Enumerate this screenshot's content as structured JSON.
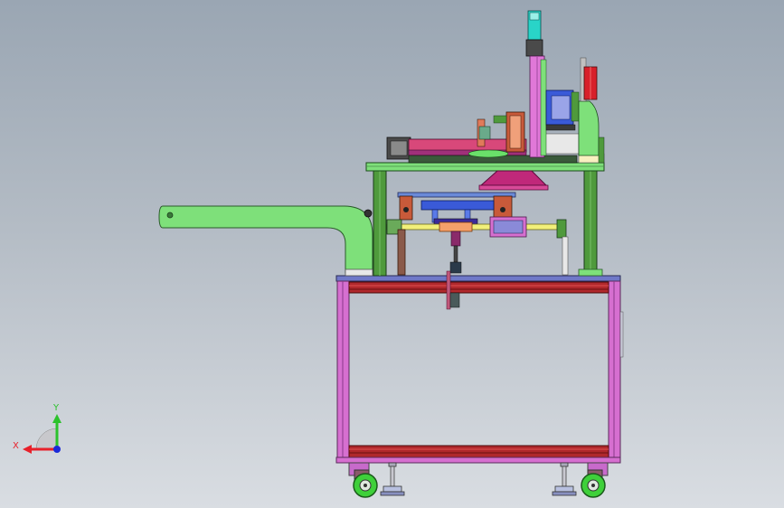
{
  "viewport": {
    "background_top": "#9aa6b3",
    "background_bottom": "#d9dde2"
  },
  "triad": {
    "x_label": "X",
    "y_label": "Y",
    "x_color": "#e8202a",
    "y_color": "#2cc22c",
    "z_color": "#1a2ad8"
  },
  "colors": {
    "frame_pink": "#d66fd0",
    "frame_red": "#b0282c",
    "frame_blue": "#5a64c8",
    "arm_green": "#7ee07a",
    "post_green": "#4f9a3c",
    "hood_magenta": "#c0287a",
    "rail_yellow": "#f2f07a",
    "caster_green": "#3ed03a"
  }
}
